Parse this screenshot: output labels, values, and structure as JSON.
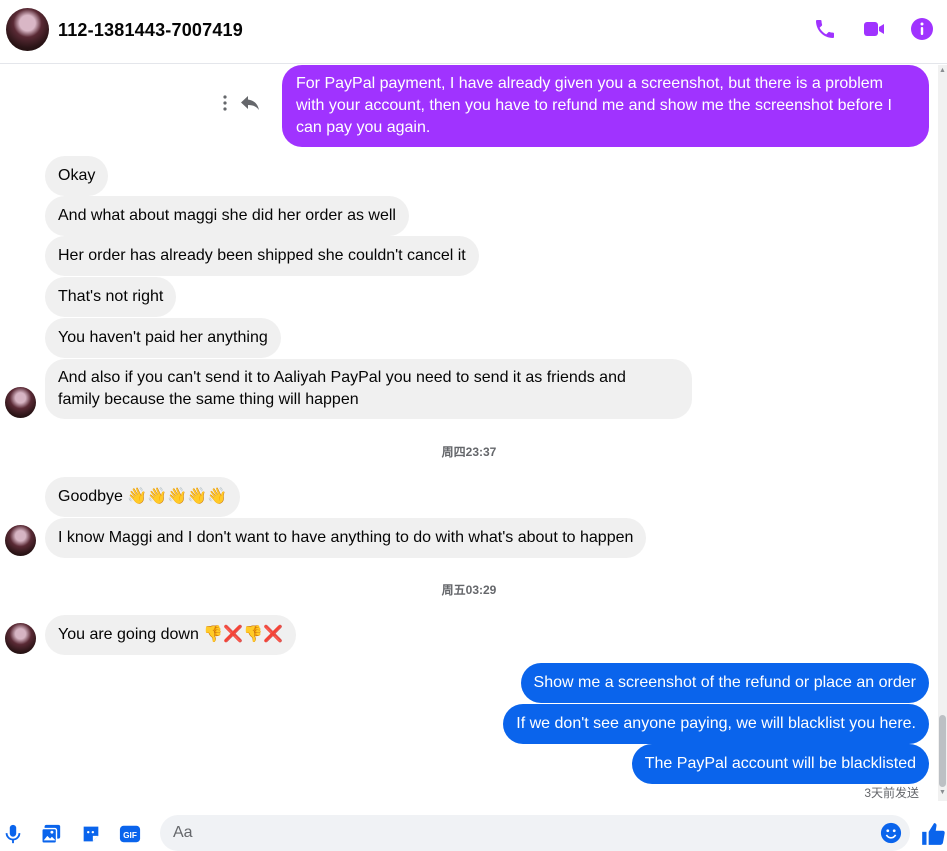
{
  "header": {
    "title": "112-1381443-7007419"
  },
  "colors": {
    "accent": "#a033ff",
    "outgoing_purple": "#a033ff",
    "outgoing_blue": "#0a64ec",
    "incoming": "#f0f0f0"
  },
  "messages": {
    "m1": "For PayPal payment, I have already given you a screenshot, but there is a problem with your account, then you have to refund me and show me the screenshot before I can pay you again.",
    "m2": "Okay",
    "m3": "And what about maggi she did her order as well",
    "m4": "Her order has already been shipped she couldn't cancel it",
    "m5": "That's not right",
    "m6": "You haven't paid her anything",
    "m7a": "And also if you can't send it to Aaliyah PayPal you need to send it as friends and",
    "m7b": "family because the same thing will happen",
    "m8": "Goodbye 👋👋👋👋👋",
    "m9": "I know Maggi and I don't want to have anything to do with what's about to happen",
    "m10": "You are going down 👎❌👎❌",
    "m11": "Show me a screenshot of the refund or place an order",
    "m12": "If we don't see anyone paying, we will blacklist you here.",
    "m13": "The PayPal account will be blacklisted"
  },
  "timestamps": {
    "t1": "周四23:37",
    "t2": "周五03:29"
  },
  "status": {
    "sent": "3天前发送"
  },
  "composer": {
    "placeholder": "Aa"
  },
  "icons": {
    "header": [
      "phone-icon",
      "video-icon",
      "info-icon"
    ],
    "composer": [
      "microphone-icon",
      "image-icon",
      "sticker-icon",
      "gif-icon",
      "emoji-icon",
      "thumbs-up-icon"
    ],
    "message_actions": [
      "more-options-icon",
      "reply-icon"
    ]
  }
}
